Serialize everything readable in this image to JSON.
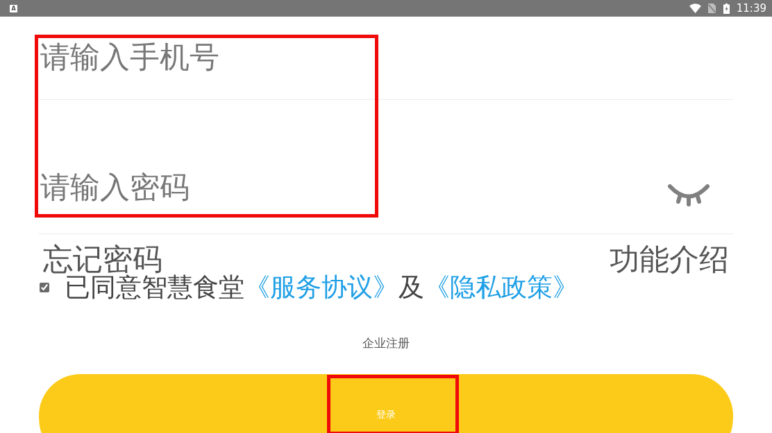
{
  "status_bar": {
    "notification": "A",
    "time": "11:39"
  },
  "credentials": {
    "highlighted": true,
    "phone_field": {
      "placeholder": "请输入手机号"
    },
    "password_field": {
      "placeholder": "请输入密码",
      "password_visible": false
    }
  },
  "forgot_password": "忘记密码",
  "feature_intro": "功能介绍",
  "agreement": {
    "checked": true,
    "parts": [
      {
        "kind": "text",
        "text": "已同意智慧食堂"
      },
      {
        "kind": "link",
        "text": "《服务协议》"
      },
      {
        "kind": "text",
        "text": "及"
      },
      {
        "kind": "link",
        "text": "《隐私政策》"
      }
    ]
  },
  "register_link": "企业注册",
  "login_button": {
    "label": "登录",
    "highlighted": true
  }
}
